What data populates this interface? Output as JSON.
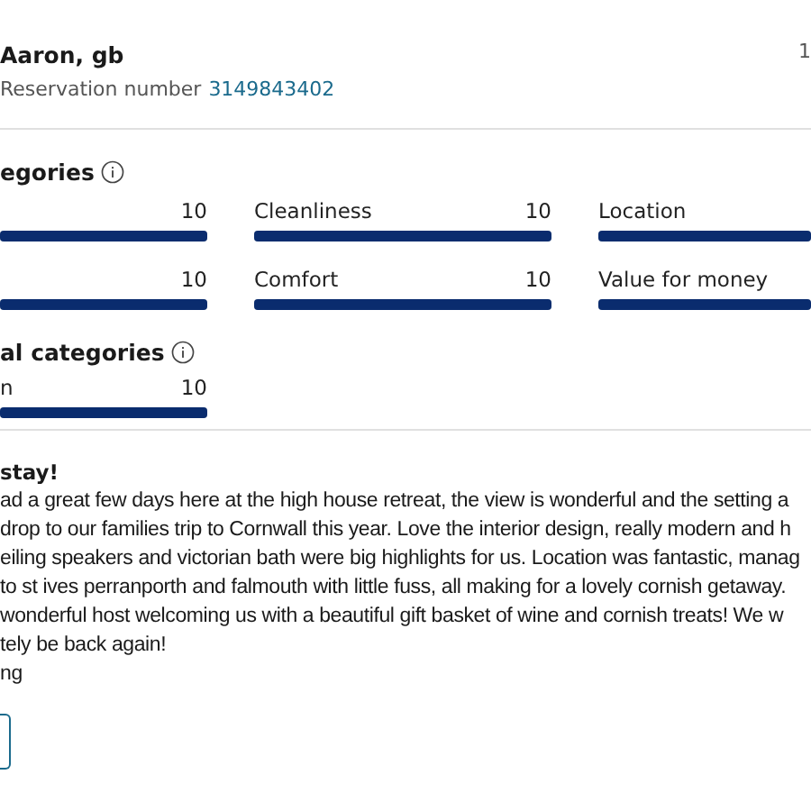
{
  "header": {
    "name": "Aaron, gb",
    "reservation_label": "Reservation number",
    "reservation_number": "3149843402",
    "corner": "1"
  },
  "categories": {
    "title": "egories",
    "items": [
      {
        "value": "10",
        "level": 1
      },
      {
        "label": "Cleanliness",
        "value": "10",
        "level": 1
      },
      {
        "label": "Location",
        "level": 1
      },
      {
        "value": "10",
        "level": 1
      },
      {
        "label": "Comfort",
        "value": "10",
        "level": 1
      },
      {
        "label": "Value for money",
        "level": 1
      }
    ]
  },
  "additional_categories": {
    "title": "al categories",
    "items": [
      {
        "label": "n",
        "value": "10",
        "level": 1
      }
    ]
  },
  "review": {
    "title": "stay!",
    "lines": [
      "ad a great few days here at the high house retreat, the view is wonderful and the setting a",
      "drop to our families trip to Cornwall this year. Love the interior design, really modern and h",
      "eiling speakers and victorian bath were big highlights for us. Location was fantastic, manag",
      "to st ives perranporth and falmouth with little fuss, all making for a lovely cornish getaway.",
      "wonderful host welcoming us with a beautiful gift basket of wine and cornish treats! We w",
      "tely be back again!",
      "ng"
    ]
  }
}
